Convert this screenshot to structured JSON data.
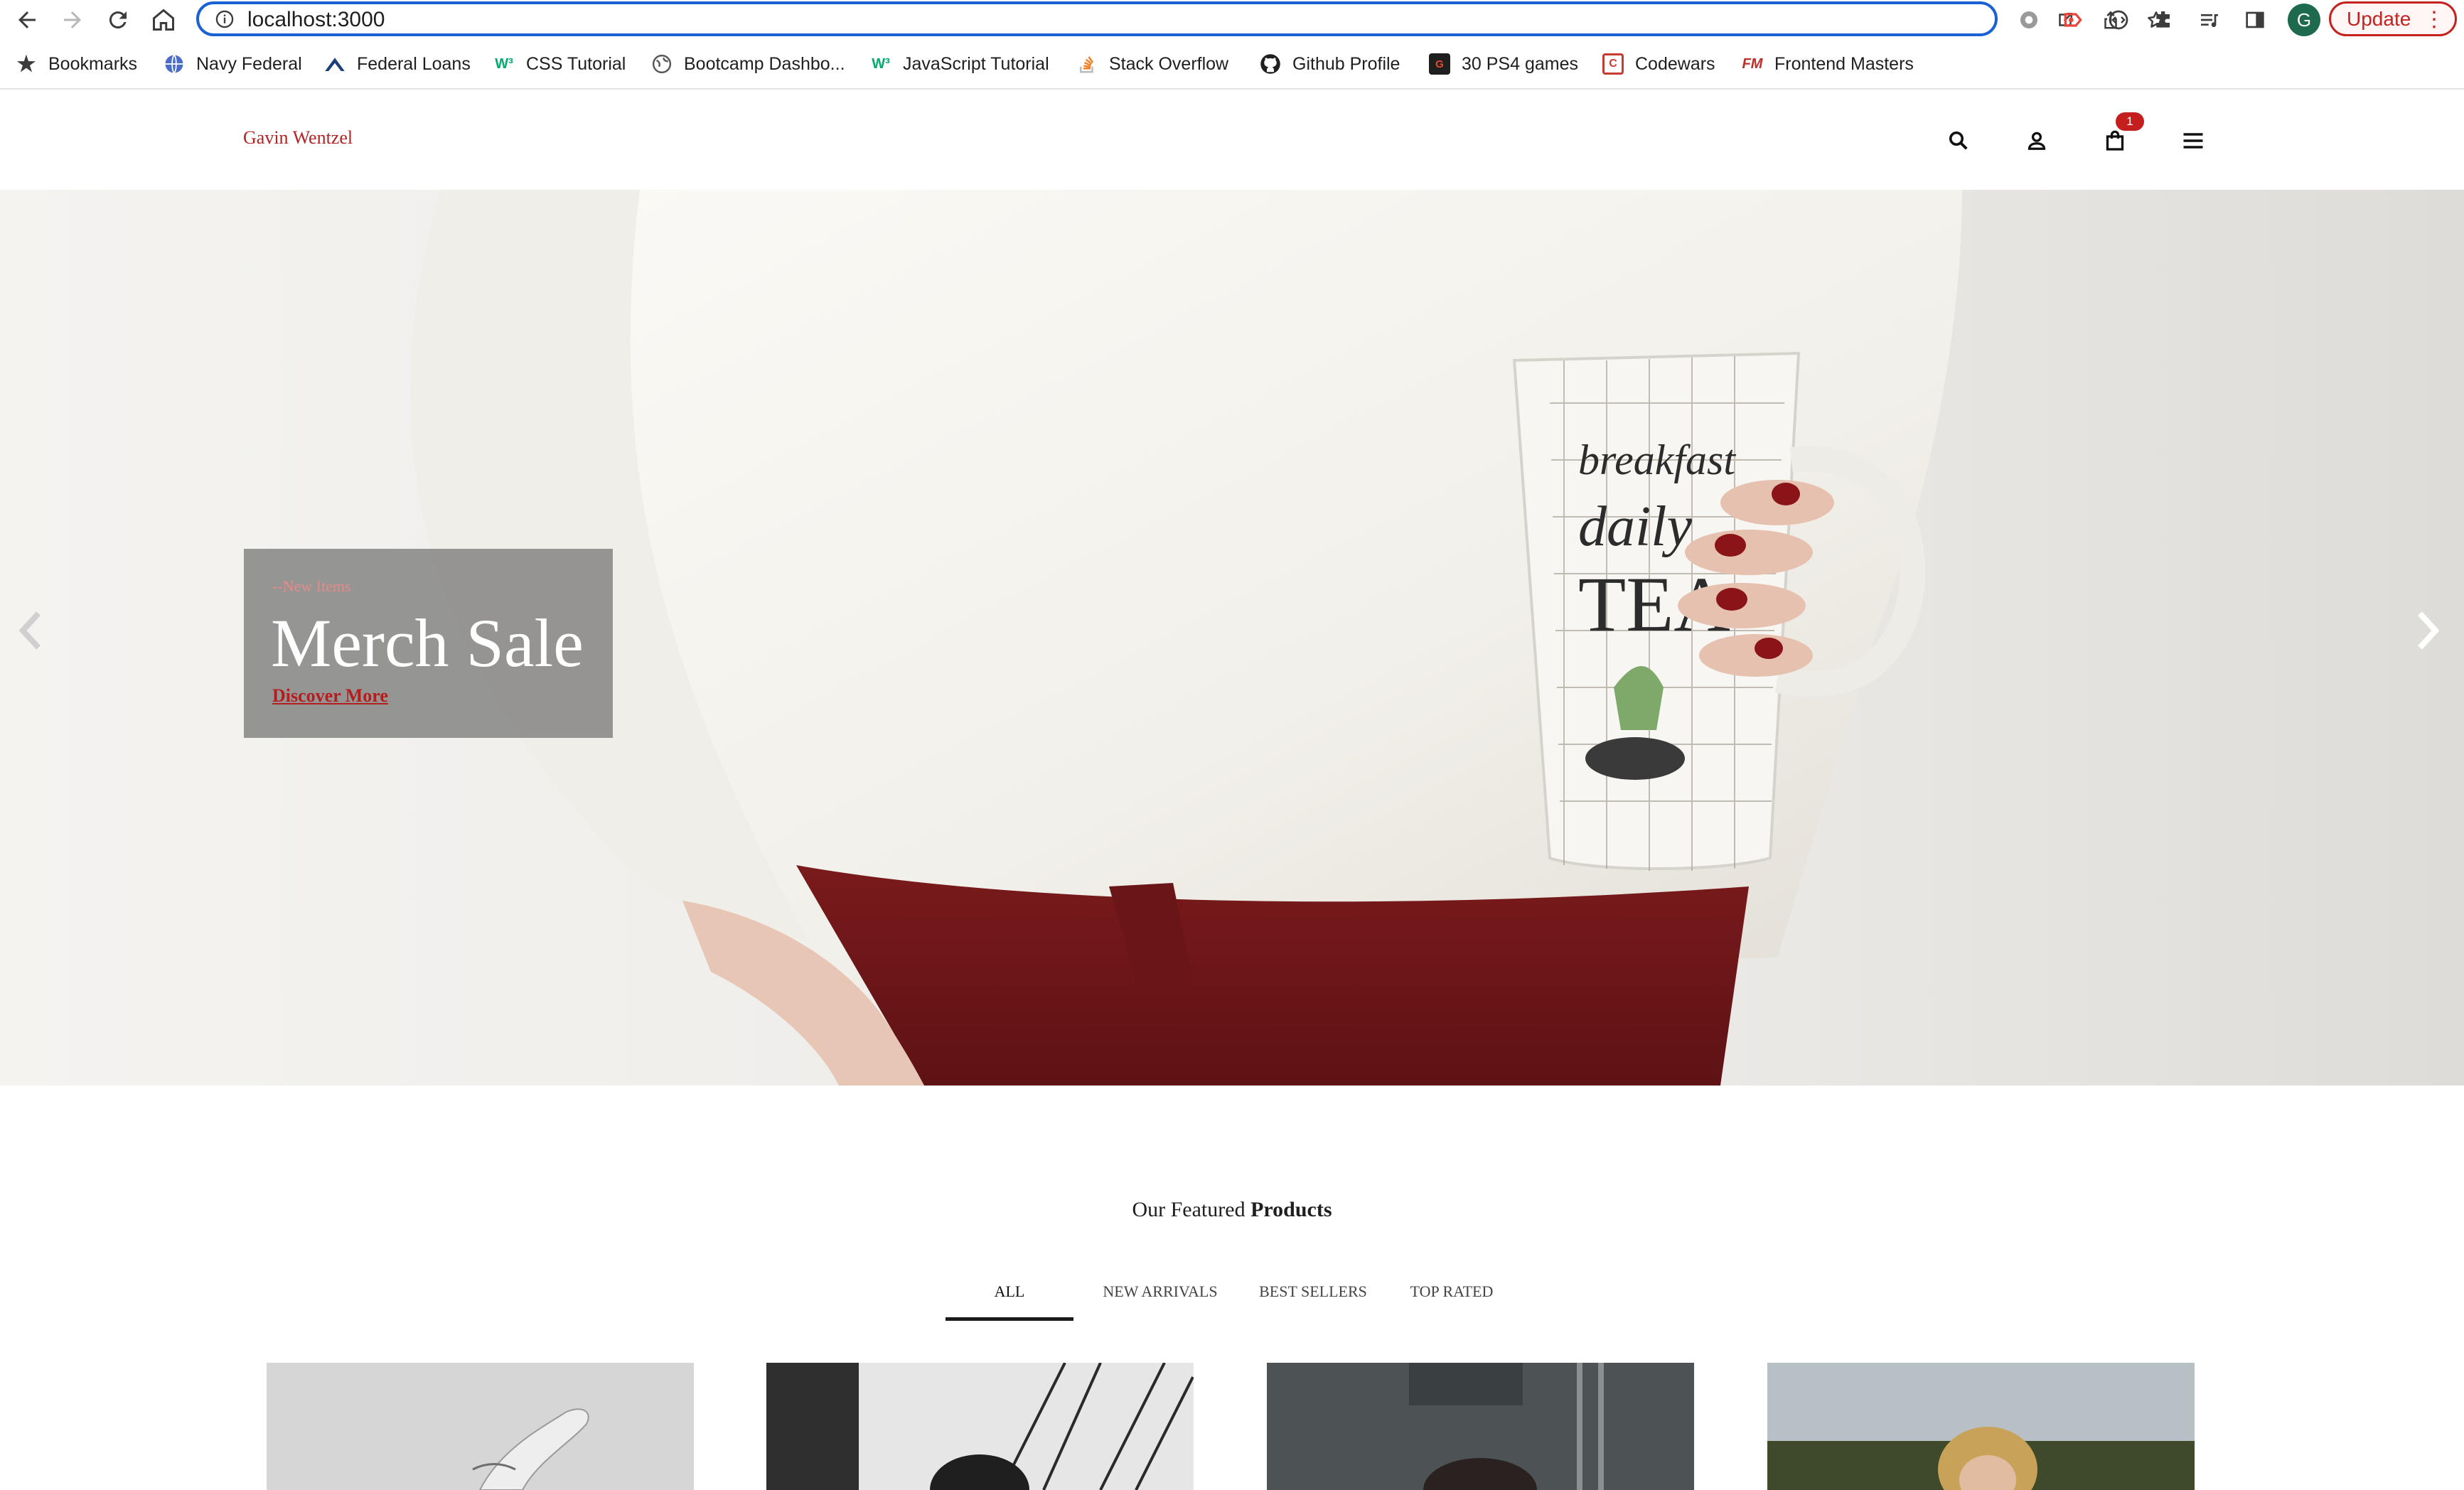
{
  "browser": {
    "url": "localhost:3000",
    "update_label": "Update",
    "profile_initial": "G",
    "bookmarks": [
      {
        "label": "Bookmarks",
        "icon": "star-icon"
      },
      {
        "label": "Navy Federal",
        "icon": "globe-icon"
      },
      {
        "label": "Federal Loans",
        "icon": "federal-loans-logo-icon"
      },
      {
        "label": "CSS Tutorial",
        "icon": "w3schools-logo-icon"
      },
      {
        "label": "Bootcamp Dashbo...",
        "icon": "globe-icon"
      },
      {
        "label": "JavaScript Tutorial",
        "icon": "w3schools-logo-icon"
      },
      {
        "label": "Stack Overflow",
        "icon": "stack-overflow-logo-icon"
      },
      {
        "label": "Github Profile",
        "icon": "github-logo-icon"
      },
      {
        "label": "30 PS4 games",
        "icon": "games-site-logo-icon"
      },
      {
        "label": "Codewars",
        "icon": "codewars-logo-icon"
      },
      {
        "label": "Frontend Masters",
        "icon": "frontend-masters-logo-icon"
      }
    ]
  },
  "header": {
    "brand": "Gavin Wentzel",
    "cart_count": "1"
  },
  "hero": {
    "kicker": "--New Items",
    "title": "Merch Sale",
    "cta": "Discover More"
  },
  "featured": {
    "heading_prefix": "Our Featured",
    "heading_bold": "Products",
    "tabs": [
      "ALL",
      "NEW ARRIVALS",
      "BEST SELLERS",
      "TOP RATED"
    ],
    "active_tab": "ALL"
  },
  "colors": {
    "accent": "#b42323",
    "cart_badge": "#c41e1e",
    "focus_ring": "#1a61d6"
  }
}
